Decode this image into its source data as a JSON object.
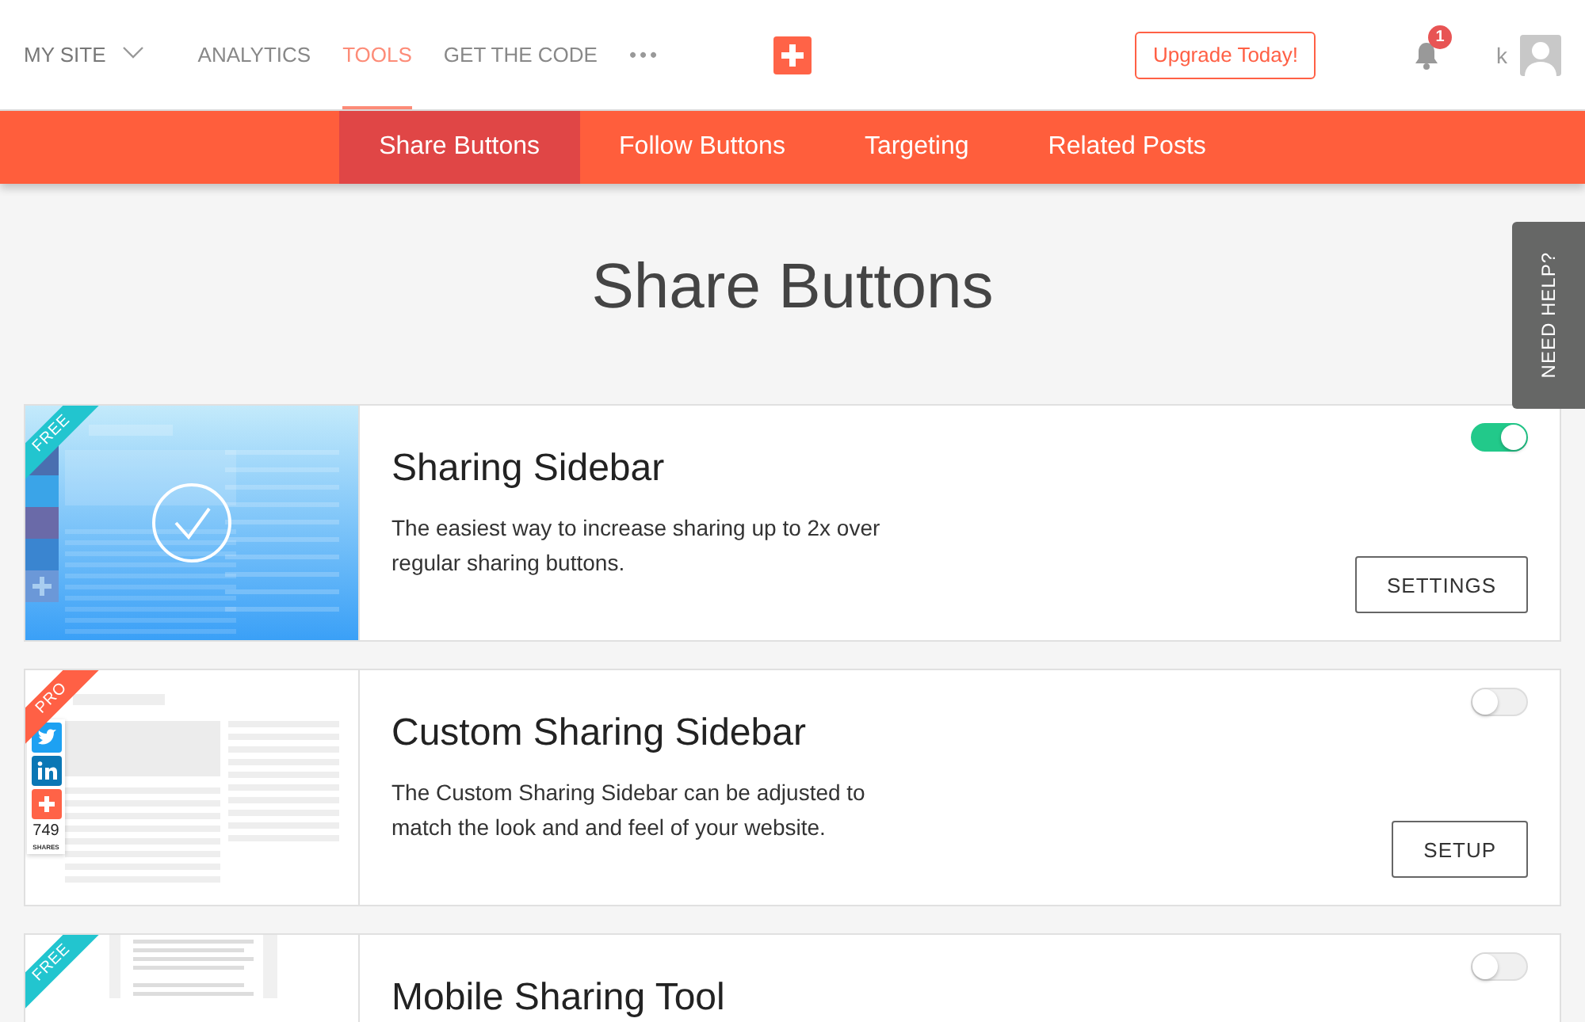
{
  "header": {
    "site_menu": "MY SITE",
    "nav": [
      {
        "label": "ANALYTICS",
        "selected": false
      },
      {
        "label": "TOOLS",
        "selected": true
      },
      {
        "label": "GET THE CODE",
        "selected": false
      }
    ],
    "more": "•••",
    "upgrade_button": "Upgrade Today!",
    "notification_count": "1",
    "user_initial": "k"
  },
  "tabs": [
    {
      "label": "Share Buttons",
      "selected": true
    },
    {
      "label": "Follow Buttons",
      "selected": false
    },
    {
      "label": "Targeting",
      "selected": false
    },
    {
      "label": "Related Posts",
      "selected": false
    }
  ],
  "page_title": "Share Buttons",
  "help_tab": "NEED HELP?",
  "cards": [
    {
      "title": "Sharing Sidebar",
      "description": "The easiest way to increase sharing up to 2x over regular sharing buttons.",
      "badge": {
        "label": "FREE",
        "kind": "free"
      },
      "enabled": true,
      "button": "SETTINGS",
      "preview": {
        "kind": "sidebar-active"
      }
    },
    {
      "title": "Custom Sharing Sidebar",
      "description": "The Custom Sharing Sidebar can be adjusted to match the look and and feel of your website.",
      "badge": {
        "label": "PRO",
        "kind": "pro"
      },
      "enabled": false,
      "button": "SETUP",
      "preview": {
        "kind": "sidebar-custom",
        "share_count": "749",
        "share_label": "SHARES"
      }
    },
    {
      "title": "Mobile Sharing Tool",
      "badge": {
        "label": "FREE",
        "kind": "free"
      },
      "enabled": false,
      "preview": {
        "kind": "mobile"
      }
    }
  ]
}
